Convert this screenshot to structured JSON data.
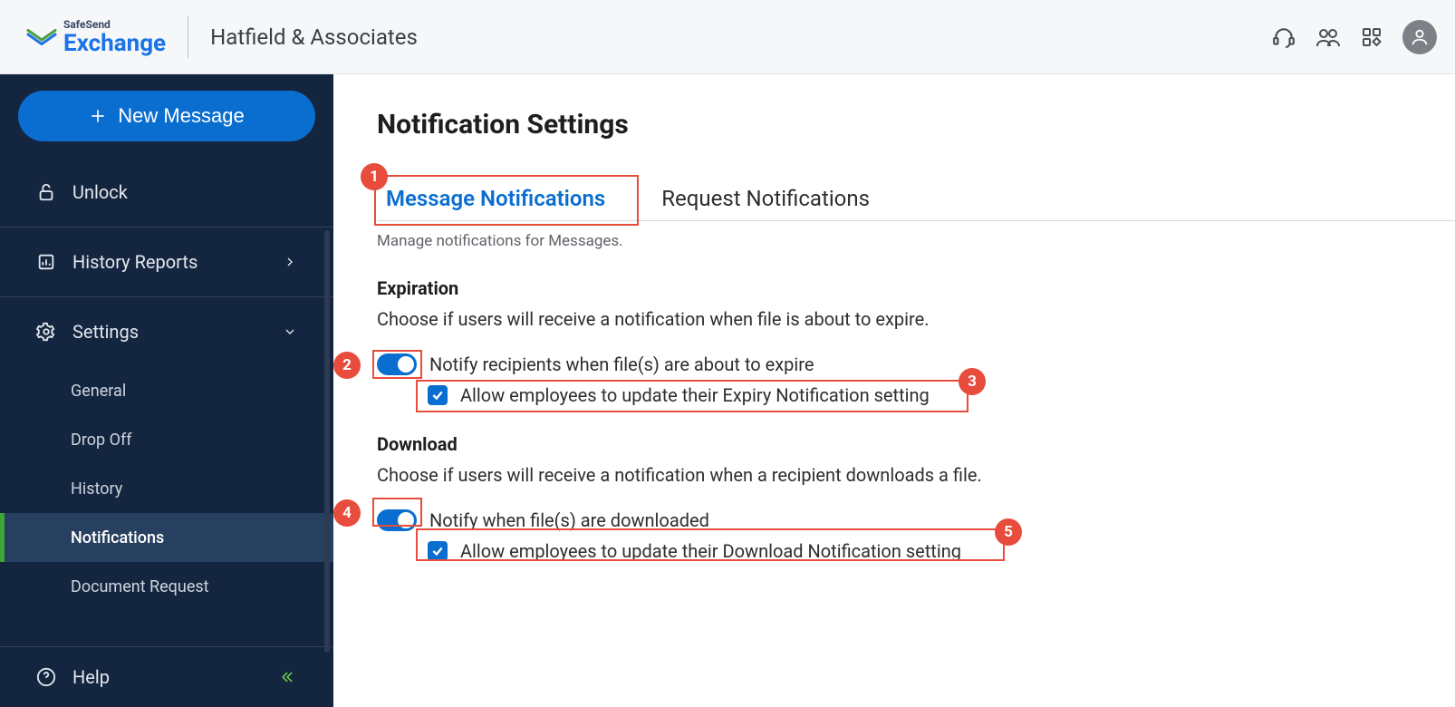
{
  "header": {
    "brand_top": "SafeSend",
    "brand_bottom": "Exchange",
    "company": "Hatfield & Associates"
  },
  "sidebar": {
    "new_message": "New Message",
    "items": {
      "unlock": "Unlock",
      "history_reports": "History Reports",
      "settings": "Settings",
      "help": "Help"
    },
    "settings_children": {
      "general": "General",
      "drop_off": "Drop Off",
      "history": "History",
      "notifications": "Notifications",
      "document_request": "Document Request"
    }
  },
  "page": {
    "title": "Notification Settings",
    "tabs": {
      "message": "Message Notifications",
      "request": "Request Notifications"
    },
    "subtitle": "Manage notifications for Messages.",
    "expiration": {
      "heading": "Expiration",
      "description": "Choose if users will receive a notification when file is about to expire.",
      "toggle_label": "Notify recipients when file(s) are about to expire",
      "checkbox_label": "Allow employees to update their Expiry Notification setting"
    },
    "download": {
      "heading": "Download",
      "description": "Choose if users will receive a notification when a recipient downloads a file.",
      "toggle_label": "Notify when file(s) are downloaded",
      "checkbox_label": "Allow employees to update their Download Notification setting"
    }
  },
  "annotations": {
    "b1": "1",
    "b2": "2",
    "b3": "3",
    "b4": "4",
    "b5": "5"
  }
}
